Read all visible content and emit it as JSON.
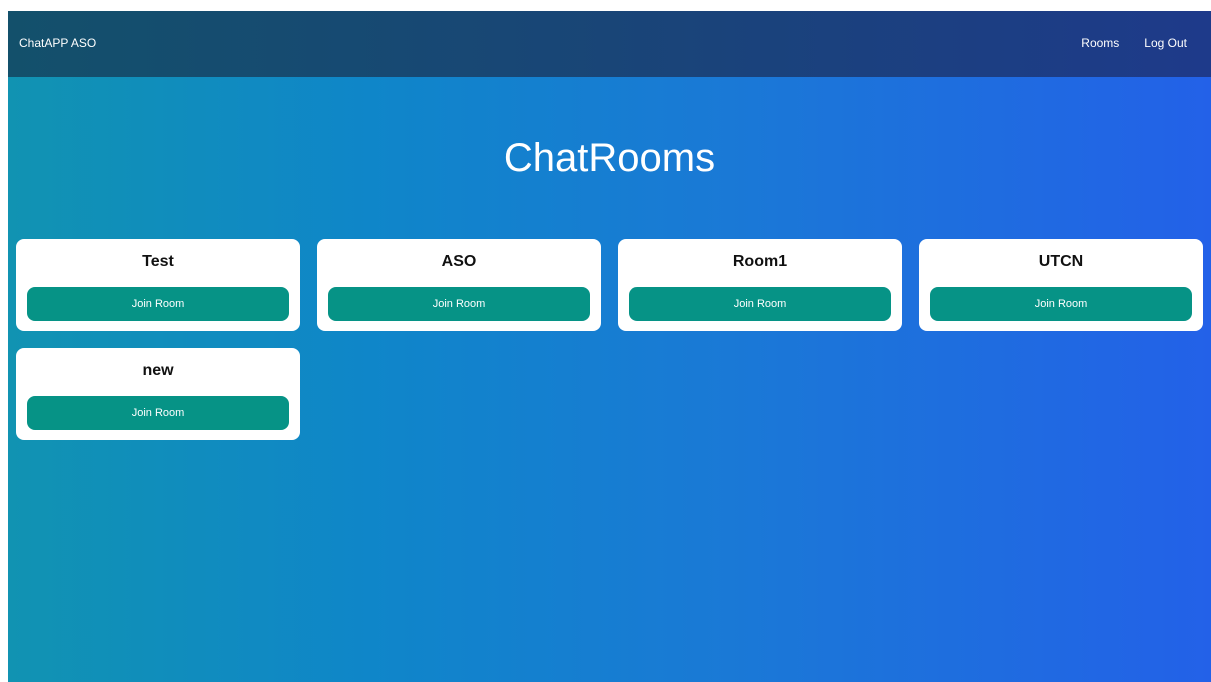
{
  "navbar": {
    "brand": "ChatAPP ASO",
    "links": [
      {
        "label": "Rooms"
      },
      {
        "label": "Log Out"
      }
    ]
  },
  "main": {
    "title": "ChatRooms",
    "rooms": [
      {
        "name": "Test",
        "button_label": "Join Room"
      },
      {
        "name": "ASO",
        "button_label": "Join Room"
      },
      {
        "name": "Room1",
        "button_label": "Join Room"
      },
      {
        "name": "UTCN",
        "button_label": "Join Room"
      },
      {
        "name": "new",
        "button_label": "Join Room"
      }
    ]
  },
  "colors": {
    "button": "#069386",
    "card": "#ffffff",
    "text_on_dark": "#ffffff"
  }
}
